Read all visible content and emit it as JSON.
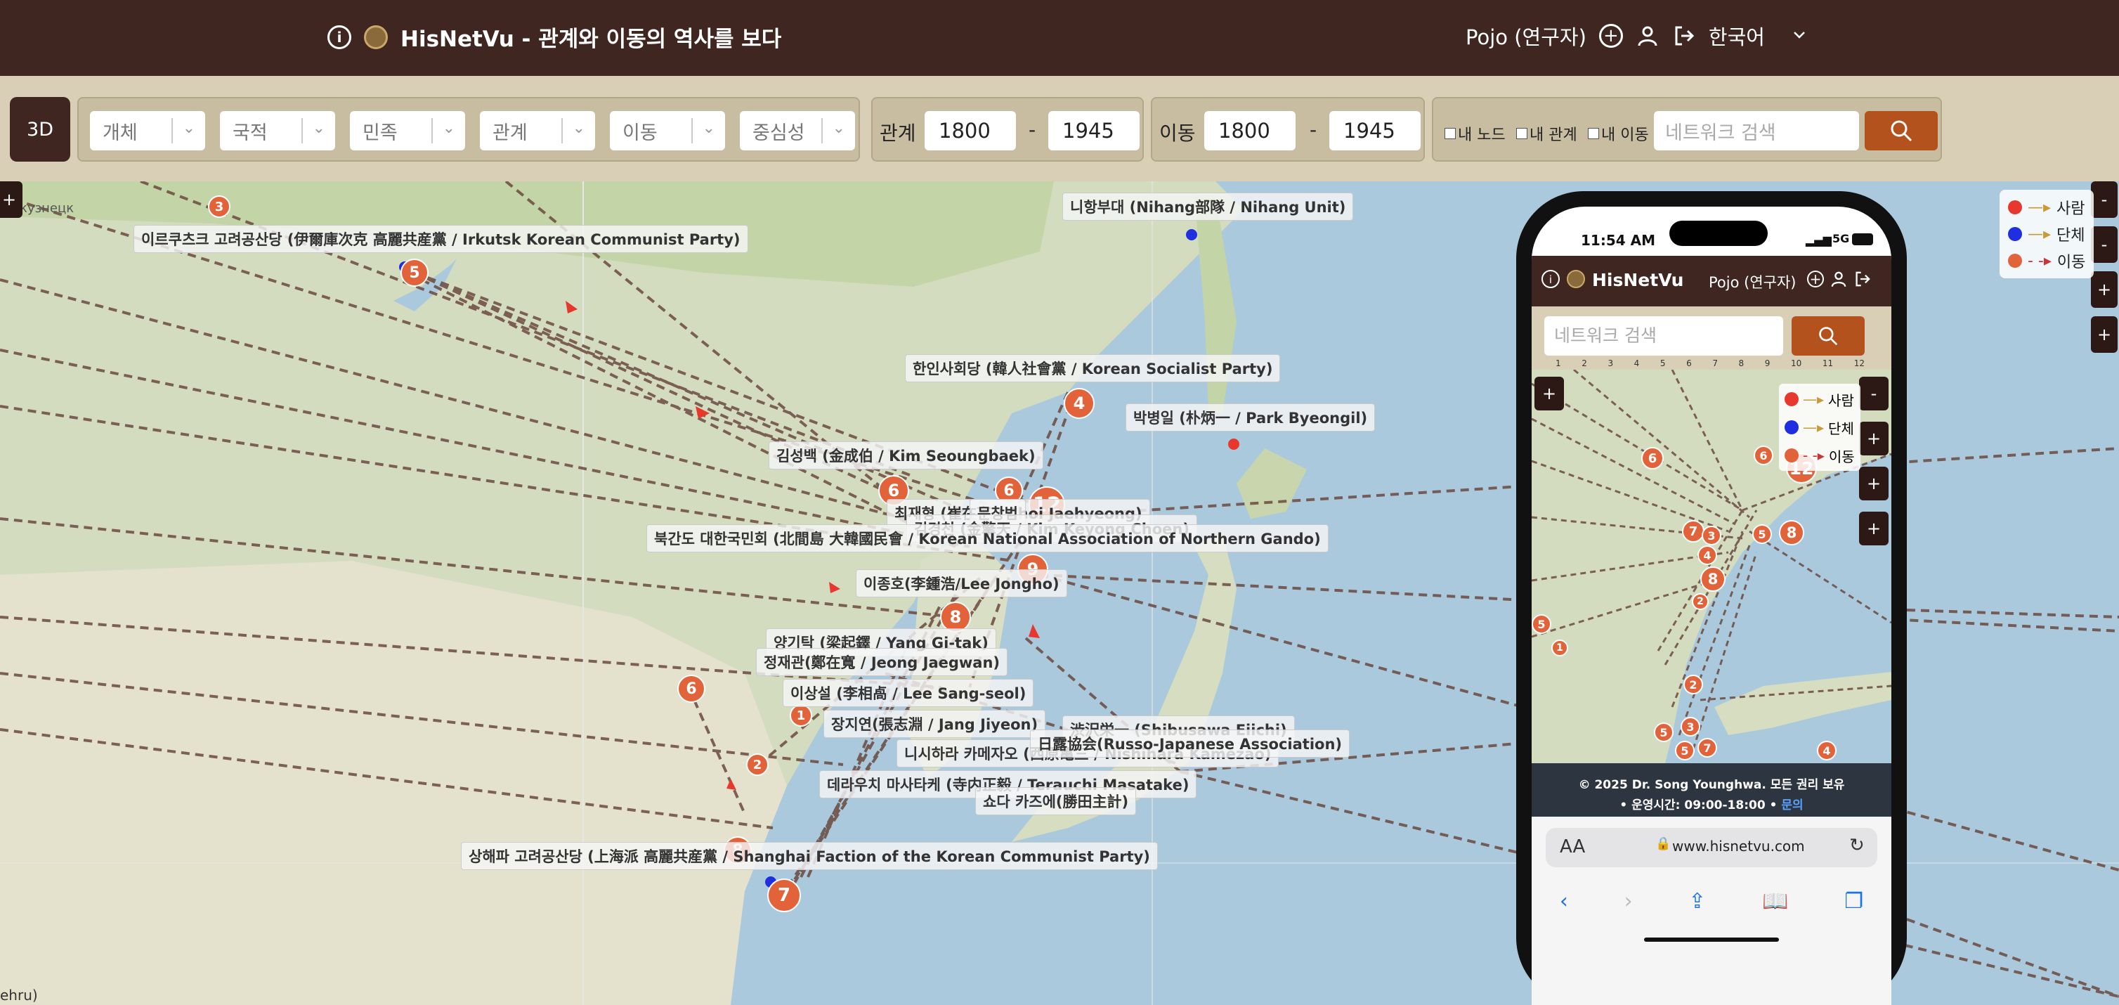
{
  "header": {
    "info_icon": "info-icon",
    "logo_icon": "globe-logo-icon",
    "title": "HisNetVu - 관계와 이동의 역사를 보다",
    "user_label": "Pojo (연구자)",
    "language": "한국어"
  },
  "toolbar": {
    "mode_button": "3D",
    "filters": [
      "개체",
      "국적",
      "민족",
      "관계",
      "이동",
      "중심성"
    ],
    "relation_label": "관계",
    "relation_from": "1800",
    "relation_to": "1945",
    "movement_label": "이동",
    "movement_from": "1800",
    "movement_to": "1945",
    "dash": "-",
    "checkboxes": [
      "내 노드",
      "내 관계",
      "내 이동"
    ],
    "search_placeholder": "네트워크 검색"
  },
  "map": {
    "labels": [
      "이르쿠츠크 고려공산당 (伊爾庫次克 高麗共産黨 / Irkutsk Korean Communist Party)",
      "니항부대 (Nihang部隊 / Nihang Unit)",
      "한인사회당 (韓人社會黨 / Korean Socialist Party)",
      "박병일 (朴炳一 / Park Byeongil)",
      "김성백 (金成伯 / Kim Seoungbaek)",
      "최재형 (崔在亨 / Choi Jaehyeong)",
      "문창범",
      "김경천 (金擎天 / Kim Keyong Choen)",
      "북간도 대한국민회 (北間島 大韓國民會 / Korean National Association of Northern Gando)",
      "이종호(李鍾浩/Lee Jongho)",
      "양기탁 (梁起鐸 / Yang Gi-tak)",
      "정재관(鄭在寬 / Jeong Jaegwan)",
      "이상설 (李相卨 / Lee Sang-seol)",
      "장지연(張志淵 / Jang Jiyeon)",
      "니시하라 카메자오 (西原亀三 / Nishihara Kamezao)",
      "渋沢栄一 (Shibusawa Eiichi)",
      "日露協会(Russo-Japanese Association)",
      "데라우치 마사타케 (寺内正毅 / Terauchi Masatake)",
      "쇼다 카즈에(勝田主計)",
      "상해파 고려공산당 (上海派 高麗共産黨 / Shanghai Faction of the Korean Communist Party)"
    ],
    "clusters": [
      "3",
      "5",
      "6",
      "6",
      "4",
      "12",
      "9",
      "8",
      "6",
      "1",
      "2",
      "7",
      "8"
    ],
    "edge_text": "ehru)",
    "edge_text_top": "кузнецк",
    "zoom_left": "+",
    "zoom_right": [
      "-",
      "-",
      "+",
      "+"
    ],
    "legend": [
      {
        "label": "사람",
        "color": "#e8372c"
      },
      {
        "label": "단체",
        "color": "#1f2ee0"
      },
      {
        "label": "이동",
        "color": "#e2623a"
      }
    ],
    "colors": {
      "edge": "#6b4a3f",
      "cluster": "#e2623a",
      "arrow": "#e8372c"
    }
  },
  "phone": {
    "time": "11:54 AM",
    "signal": "5G",
    "title": "HisNetVu",
    "user_label": "Pojo (연구자)",
    "search_placeholder": "네트워크 검색",
    "ruler": [
      "1",
      "2",
      "3",
      "4",
      "5",
      "6",
      "7",
      "8",
      "9",
      "10",
      "11",
      "12"
    ],
    "zoom": [
      "+",
      "-",
      "+",
      "+",
      "+"
    ],
    "legend": [
      {
        "label": "사람",
        "color": "#e8372c"
      },
      {
        "label": "단체",
        "color": "#1f2ee0"
      },
      {
        "label": "이동",
        "color": "#e2623a"
      }
    ],
    "clusters": [
      "6",
      "6",
      "12",
      "7",
      "3",
      "4",
      "5",
      "8",
      "8",
      "5",
      "2",
      "1",
      "2",
      "5",
      "3",
      "5",
      "7",
      "1",
      "4"
    ],
    "footer_line1": "© 2025 Dr. Song Younghwa. 모든 권리 보유",
    "footer_line2": "• 운영시간: 09:00-18:00 •",
    "footer_link": "문의",
    "text_size": "AA",
    "url": "www.hisnetvu.com"
  }
}
